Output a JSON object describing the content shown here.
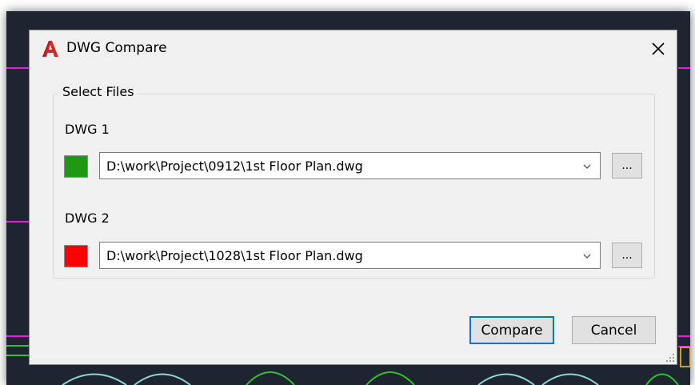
{
  "dialog": {
    "title": "DWG Compare",
    "close_icon": "close-icon"
  },
  "group": {
    "legend": "Select Files"
  },
  "files": [
    {
      "label": "DWG 1",
      "path": "D:\\work\\Project\\0912\\1st Floor Plan.dwg",
      "color": "#1e9a12",
      "browse": "..."
    },
    {
      "label": "DWG 2",
      "path": "D:\\work\\Project\\1028\\1st Floor Plan.dwg",
      "color": "#ff0000",
      "browse": "..."
    }
  ],
  "buttons": {
    "compare": "Compare",
    "cancel": "Cancel"
  },
  "colors": {
    "accent": "#0078d7",
    "cad_background": "#1e2430",
    "cad_magenta": "#e020e0",
    "cad_green": "#30c030"
  }
}
